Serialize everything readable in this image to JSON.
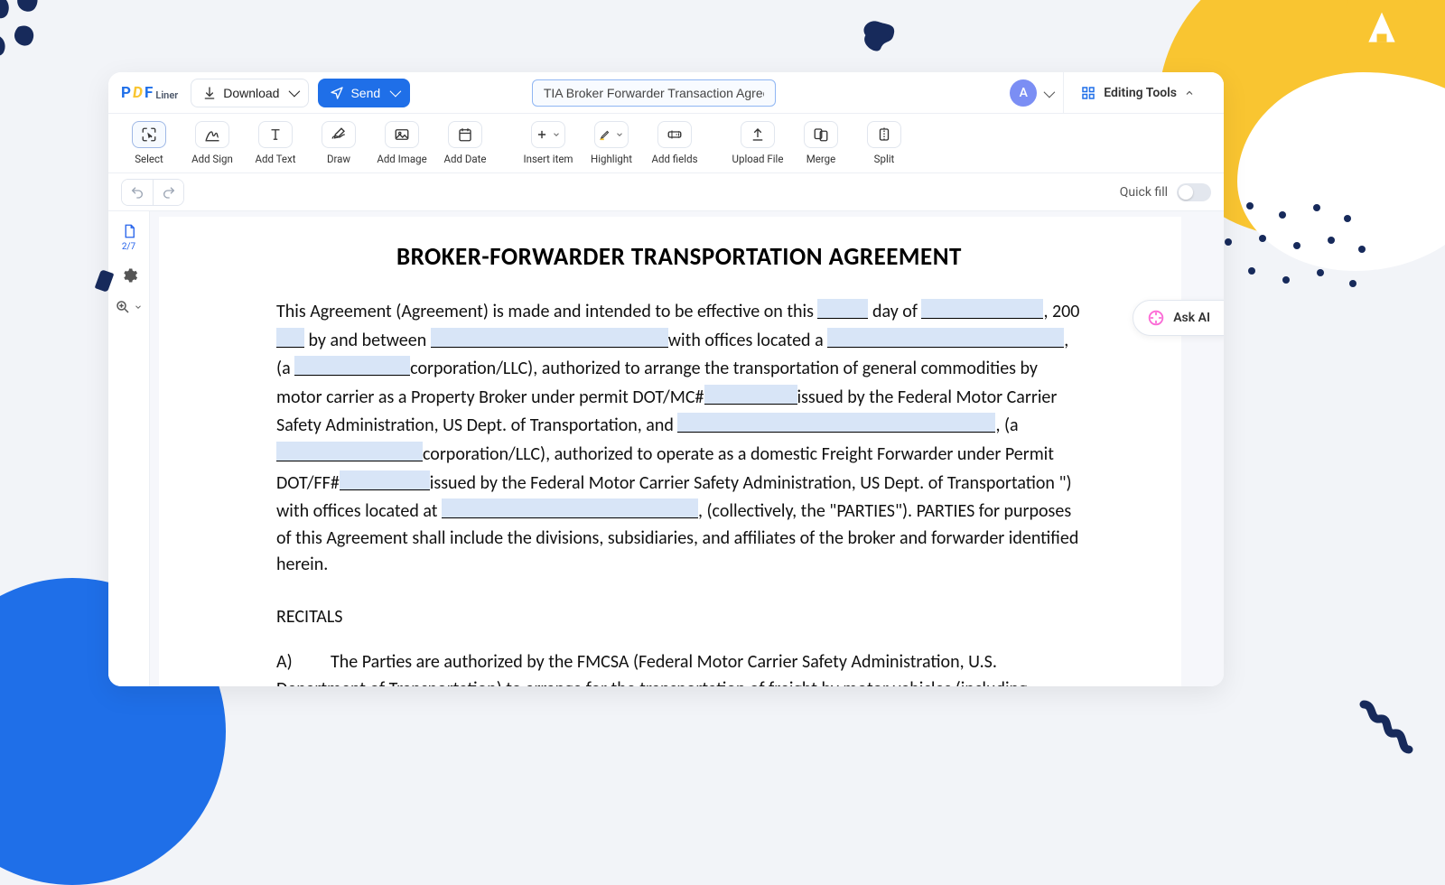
{
  "app_name": "PDFLiner",
  "topbar": {
    "download": "Download",
    "send": "Send",
    "doc_title": "TIA Broker Forwarder Transaction Agreement",
    "avatar_letter": "A",
    "editing_tools": "Editing Tools"
  },
  "toolbar": {
    "select": "Select",
    "add_sign": "Add Sign",
    "add_text": "Add Text",
    "draw": "Draw",
    "add_image": "Add Image",
    "add_date": "Add Date",
    "insert_item": "Insert item",
    "highlight": "Highlight",
    "add_fields": "Add fields",
    "upload_file": "Upload File",
    "merge": "Merge",
    "split": "Split"
  },
  "subbar": {
    "quick_fill": "Quick fill"
  },
  "left_rail": {
    "page_counter": "2/7"
  },
  "ask_ai": "Ask AI",
  "document": {
    "heading": "BROKER-FORWARDER TRANSPORTATION AGREEMENT",
    "p1_a": "This Agreement (Agreement) is made and intended to be effective on this ",
    "p1_b": " day of ",
    "p1_c": ", 200",
    "p1_d": " by and between ",
    "p1_e": "with offices located a ",
    "p1_f": ", (a ",
    "p1_g": "corporation/LLC), authorized to arrange the transportation of general commodities by motor carrier as a Property Broker  under permit DOT/MC#",
    "p1_h": "issued by the Federal Motor Carrier Safety Administration, US Dept. of Transportation, and ",
    "p1_i": ", (a ",
    "p1_j": "corporation/LLC), authorized to operate as a domestic Freight Forwarder under Permit DOT/FF#",
    "p1_k": "issued by the Federal Motor Carrier Safety Administration, US Dept. of Transportation \") with offices located at ",
    "p1_l": ", (collectively, the \"PARTIES\"). PARTIES for purposes of this Agreement shall include the divisions, subsidiaries, and affiliates of the broker and forwarder identified herein.",
    "recitals": "RECITALS",
    "recital_a_prefix": "A)",
    "recital_a": "The Parties are authorized by the FMCSA (Federal Motor Carrier Safety Administration, U.S. Department of Transportation) to arrange for the transportation of freight by motor vehicles (including draymen) and/or railroad intermodal service (broker), and provide for transportation of freight assuming"
  }
}
